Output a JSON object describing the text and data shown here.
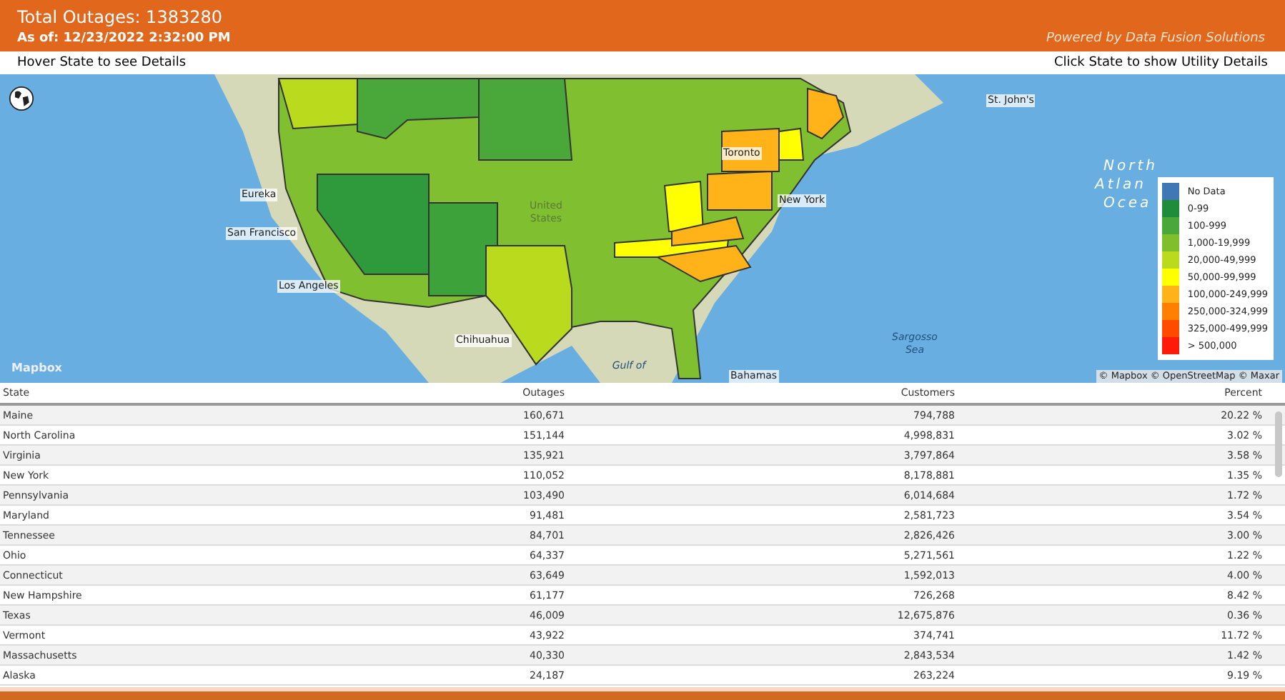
{
  "header": {
    "title": "Total Outages: 1383280",
    "as_of": "As of: 12/23/2022 2:32:00 PM",
    "powered_by": "Powered by Data Fusion Solutions"
  },
  "subheader": {
    "left": "Hover State to see Details",
    "right": "Click State to show Utility Details"
  },
  "map": {
    "labels": [
      {
        "text": "Eureka",
        "kind": "city"
      },
      {
        "text": "San Francisco",
        "kind": "city"
      },
      {
        "text": "Los Angeles",
        "kind": "city"
      },
      {
        "text": "Chihuahua",
        "kind": "city"
      },
      {
        "text": "United States",
        "kind": "country"
      },
      {
        "text": "Toronto",
        "kind": "city"
      },
      {
        "text": "New York",
        "kind": "city"
      },
      {
        "text": "St. John's",
        "kind": "city"
      },
      {
        "text": "North",
        "kind": "ocean"
      },
      {
        "text": "Atlan",
        "kind": "ocean"
      },
      {
        "text": "Ocea",
        "kind": "ocean"
      },
      {
        "text": "Sargosso Sea",
        "kind": "sea"
      },
      {
        "text": "Gulf of",
        "kind": "sea"
      },
      {
        "text": "Bahamas",
        "kind": "city"
      }
    ],
    "logo": "Mapbox",
    "attribution": "© Mapbox © OpenStreetMap © Maxar",
    "legend": [
      {
        "label": "No Data",
        "color": "#3f78b5"
      },
      {
        "label": "0-99",
        "color": "#1e8c3a"
      },
      {
        "label": "100-999",
        "color": "#4aa83a"
      },
      {
        "label": "1,000-19,999",
        "color": "#80bf2c"
      },
      {
        "label": "20,000-49,999",
        "color": "#bada1e"
      },
      {
        "label": "50,000-99,999",
        "color": "#ffff00"
      },
      {
        "label": "100,000-249,999",
        "color": "#ffb319"
      },
      {
        "label": "250,000-324,999",
        "color": "#ff8000"
      },
      {
        "label": "325,000-499,999",
        "color": "#ff4a00"
      },
      {
        "label": "> 500,000",
        "color": "#ff1a0a"
      }
    ]
  },
  "table": {
    "columns": [
      "State",
      "Outages",
      "Customers",
      "Percent"
    ],
    "rows": [
      [
        "Maine",
        "160,671",
        "794,788",
        "20.22 %"
      ],
      [
        "North Carolina",
        "151,144",
        "4,998,831",
        "3.02 %"
      ],
      [
        "Virginia",
        "135,921",
        "3,797,864",
        "3.58 %"
      ],
      [
        "New York",
        "110,052",
        "8,178,881",
        "1.35 %"
      ],
      [
        "Pennsylvania",
        "103,490",
        "6,014,684",
        "1.72 %"
      ],
      [
        "Maryland",
        "91,481",
        "2,581,723",
        "3.54 %"
      ],
      [
        "Tennessee",
        "84,701",
        "2,826,426",
        "3.00 %"
      ],
      [
        "Ohio",
        "64,337",
        "5,271,561",
        "1.22 %"
      ],
      [
        "Connecticut",
        "63,649",
        "1,592,013",
        "4.00 %"
      ],
      [
        "New Hampshire",
        "61,177",
        "726,268",
        "8.42 %"
      ],
      [
        "Texas",
        "46,009",
        "12,675,876",
        "0.36 %"
      ],
      [
        "Vermont",
        "43,922",
        "374,741",
        "11.72 %"
      ],
      [
        "Massachusetts",
        "40,330",
        "2,843,534",
        "1.42 %"
      ],
      [
        "Alaska",
        "24,187",
        "263,224",
        "9.19 %"
      ]
    ]
  }
}
